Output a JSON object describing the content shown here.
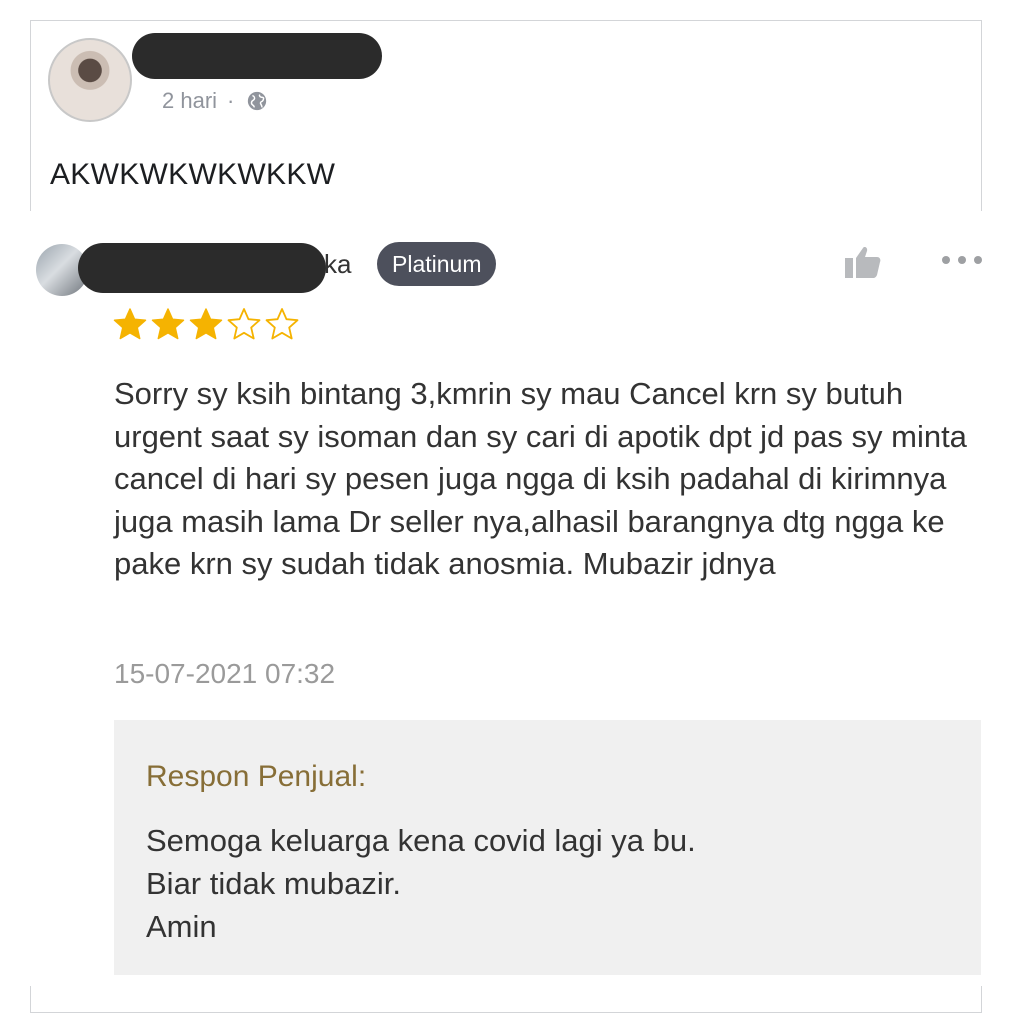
{
  "post": {
    "time": "2 hari",
    "separator": "·",
    "text": "AKWKWKWKWKKW"
  },
  "review": {
    "reviewer_name_suffix": "ka",
    "badge": "Platinum",
    "rating": 3,
    "rating_max": 5,
    "text": "Sorry sy ksih bintang 3,kmrin sy mau Cancel krn sy butuh urgent saat sy isoman dan sy cari di apotik dpt jd pas sy minta cancel di hari sy pesen juga ngga di ksih padahal di kirimnya juga masih lama Dr seller nya,alhasil barangnya dtg ngga ke pake krn sy sudah tidak anosmia. Mubazir jdnya",
    "date": "15-07-2021 07:32",
    "seller_response": {
      "title": "Respon Penjual:",
      "lines": [
        "Semoga keluarga kena covid lagi ya bu.",
        "Biar tidak mubazir.",
        "Amin"
      ]
    }
  },
  "icons": {
    "globe": "globe-icon",
    "like": "thumbs-up-icon",
    "more": "more-dots-icon",
    "star": "star-icon"
  },
  "colors": {
    "badge_bg": "#4d505c",
    "star_fill": "#f5b301",
    "seller_title": "#876e37",
    "seller_bg": "#f0f0f0"
  }
}
